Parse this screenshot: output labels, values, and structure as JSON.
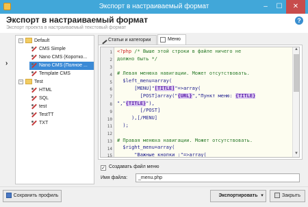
{
  "window": {
    "title": "Экспорт в настраиваемый формат",
    "minimize": "–",
    "maximize": "☐",
    "close": "✕"
  },
  "header": {
    "title": "Экспорт в настраиваемый формат",
    "subtitle": "Экспорт проекта в настраиваемый текстовый формат",
    "help": "?"
  },
  "tree": {
    "rows": [
      {
        "label": "Default",
        "kind": "folder",
        "expander": "−"
      },
      {
        "label": "CMS Simple",
        "kind": "item"
      },
      {
        "label": "Nano CMS (Коротко...",
        "kind": "item"
      },
      {
        "label": "Nano CMS (Полное ...",
        "kind": "item",
        "selected": true
      },
      {
        "label": "Template CMS",
        "kind": "item"
      },
      {
        "label": "Test",
        "kind": "folder",
        "expander": "−"
      },
      {
        "label": "HTML",
        "kind": "item"
      },
      {
        "label": "SQL",
        "kind": "item"
      },
      {
        "label": "test",
        "kind": "item"
      },
      {
        "label": "TestTT",
        "kind": "item"
      },
      {
        "label": "TXT",
        "kind": "item"
      }
    ],
    "current_marker": "›"
  },
  "tabs": [
    {
      "label": "Статьи и категории",
      "active": false
    },
    {
      "label": "Меню",
      "active": true
    }
  ],
  "editor": {
    "line_numbers": [
      "1",
      "2",
      "3",
      "4",
      "5",
      "6",
      "7",
      "8",
      "9",
      "10",
      "11",
      "12",
      "13",
      "14",
      "15"
    ]
  },
  "options": {
    "create_menu_label": "Создавать файл меню",
    "create_menu_checked": "✓",
    "filename_label": "Имя файла:",
    "filename_value": "_menu.php"
  },
  "footer": {
    "save_profile": "Сохранить профиль",
    "export": "Экспортировать",
    "export_arrow": "▾",
    "close": "Закрыть"
  },
  "colors": {
    "titlebar": "#41a7d9",
    "selection": "#3b8ad6",
    "close": "#c74c4c"
  }
}
